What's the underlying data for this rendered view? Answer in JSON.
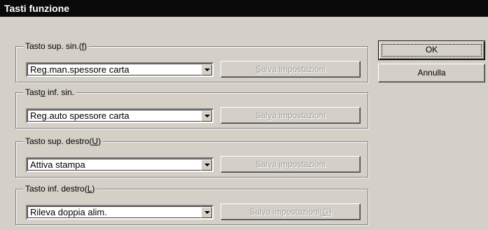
{
  "window": {
    "title": "Tasti funzione"
  },
  "groups": [
    {
      "label_pre": "Tasto sup. sin.(",
      "label_key": "f",
      "label_post": ")",
      "value": "Reg.man.spessore carta",
      "save_pre": "",
      "save_key": "S",
      "save_post": "alva impostazioni"
    },
    {
      "label_pre": "Tast",
      "label_key": "o",
      "label_post": " inf. sin.",
      "value": "Reg.auto spessore carta",
      "save_pre": "Sal",
      "save_key": "v",
      "save_post": "a impostazioni"
    },
    {
      "label_pre": "Tasto sup. destro(",
      "label_key": "U",
      "label_post": ")",
      "value": "Attiva stampa",
      "save_pre": "Salva ",
      "save_key": "i",
      "save_post": "mpostazioni"
    },
    {
      "label_pre": "Tasto inf. destro(",
      "label_key": "L",
      "label_post": ")",
      "value": "Rileva doppia alim.",
      "save_pre": "Salva impostazioni(",
      "save_key": "G",
      "save_post": ")"
    }
  ],
  "buttons": {
    "ok": "OK",
    "cancel": "Annulla"
  }
}
